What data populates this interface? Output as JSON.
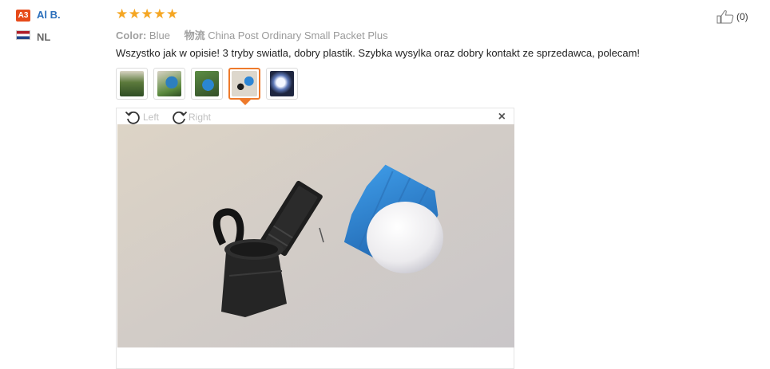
{
  "reviewer": {
    "level_badge": "A3",
    "name": "Al B.",
    "country": "NL"
  },
  "rating": {
    "stars_display": "★★★★★",
    "value": 5,
    "max": 5,
    "color": "#f5a623"
  },
  "meta": {
    "color_label": "Color:",
    "color_value": "Blue",
    "shipping_label": "物流",
    "shipping_value": "China Post Ordinary Small Packet Plus"
  },
  "review_text": "Wszystko jak w opisie! 3 tryby swiatla, dobry plastik. Szybka wysylka oraz dobry kontakt ze sprzedawca, polecam!",
  "helpful": {
    "count": "(0)",
    "icon": "thumbs-up-icon"
  },
  "thumbnails": {
    "count": 5,
    "selected_index": 3
  },
  "viewer": {
    "rotate_left": "Left",
    "rotate_right": "Right",
    "close": "×"
  },
  "colors": {
    "accent": "#ee7a2b",
    "link": "#2a6ebb",
    "badge": "#e64a19"
  }
}
